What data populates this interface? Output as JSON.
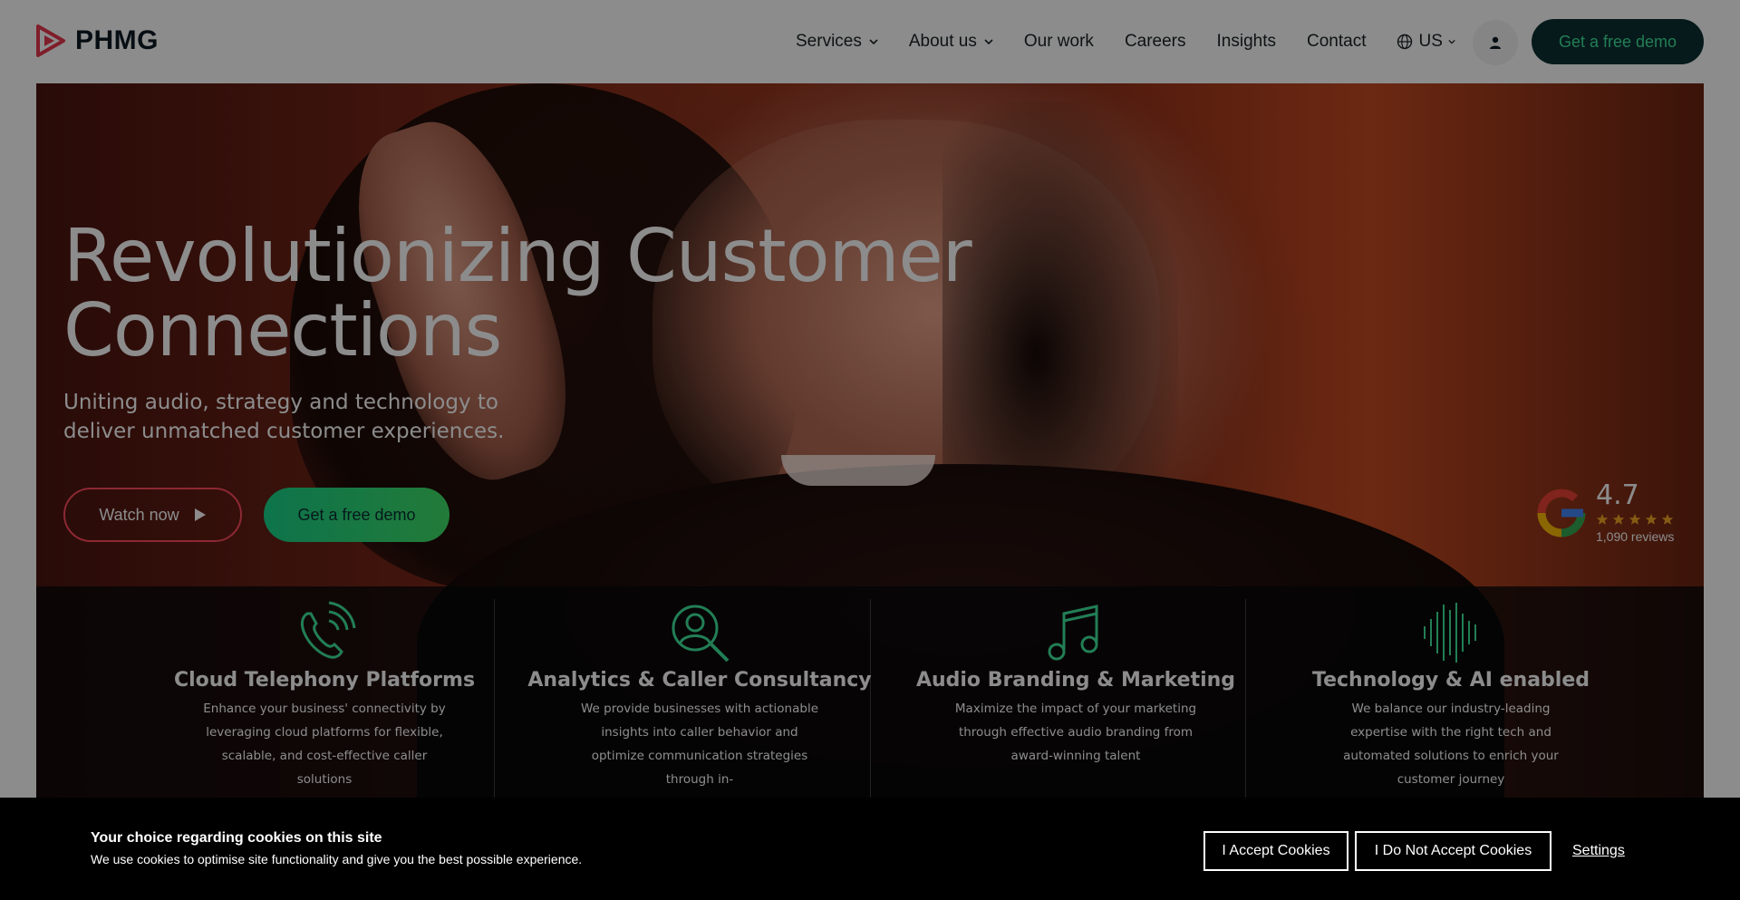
{
  "brand": {
    "name": "PHMG",
    "accent": "#e8384f"
  },
  "nav": {
    "items": [
      {
        "label": "Services",
        "has_dropdown": true
      },
      {
        "label": "About us",
        "has_dropdown": true
      },
      {
        "label": "Our work",
        "has_dropdown": false
      },
      {
        "label": "Careers",
        "has_dropdown": false
      },
      {
        "label": "Insights",
        "has_dropdown": false
      },
      {
        "label": "Contact",
        "has_dropdown": false
      }
    ],
    "locale": "US",
    "cta": "Get a free demo"
  },
  "hero": {
    "title_line1": "Revolutionizing Customer",
    "title_line2": "Connections",
    "subtitle": "Uniting audio, strategy and technology to deliver unmatched customer experiences.",
    "watch_label": "Watch now",
    "demo_label": "Get a free demo"
  },
  "rating": {
    "score": "4.7",
    "stars": 5,
    "reviews": "1,090 reviews"
  },
  "features": [
    {
      "icon": "phone-icon",
      "title": "Cloud Telephony Platforms",
      "desc": "Enhance your business' connectivity by leveraging cloud platforms for flexible, scalable, and cost-effective caller solutions"
    },
    {
      "icon": "analytics-search-icon",
      "title": "Analytics & Caller Consultancy",
      "desc": "We provide businesses with actionable insights into caller behavior and optimize communication strategies through in-"
    },
    {
      "icon": "music-note-icon",
      "title": "Audio Branding & Marketing",
      "desc": "Maximize the impact of your marketing through effective audio branding from award-winning talent"
    },
    {
      "icon": "sound-wave-icon",
      "title": "Technology & AI enabled",
      "desc": "We balance our industry-leading expertise with the right tech and automated solutions to enrich your customer journey"
    }
  ],
  "cookie": {
    "title": "Your choice regarding cookies on this site",
    "text": "We use cookies to optimise site functionality and give you the best possible experience.",
    "accept": "I Accept Cookies",
    "reject": "I Do Not Accept Cookies",
    "settings": "Settings"
  },
  "colors": {
    "dark_teal": "#0b2e32",
    "green": "#3fe59b",
    "red": "#ff4a5e"
  }
}
